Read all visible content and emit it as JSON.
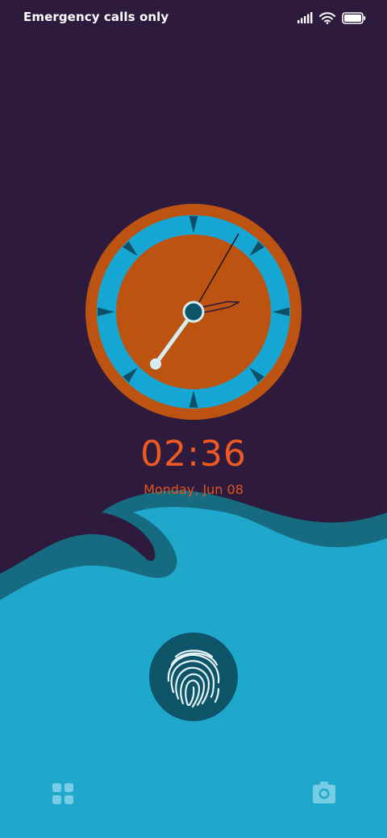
{
  "status_bar": {
    "carrier_text": "Emergency calls only",
    "icons": [
      "signal-icon",
      "wifi-icon",
      "battery-icon"
    ],
    "battery_level": 1.0
  },
  "clock": {
    "time": "02:36",
    "date": "Monday, Jun 08",
    "hour": 2,
    "minute": 36
  },
  "lockscreen": {
    "fingerprint_icon": "fingerprint-icon",
    "left_shortcut_icon": "apps-grid-icon",
    "right_shortcut_icon": "camera-icon"
  },
  "colors": {
    "background": "#2d1a3d",
    "wave_light": "#1fa8cc",
    "wave_dark": "#166b80",
    "clock_orange": "#bd5310",
    "clock_blue": "#16a6d4",
    "time_text": "#f05a22",
    "fingerprint_circle": "#0d5468"
  }
}
